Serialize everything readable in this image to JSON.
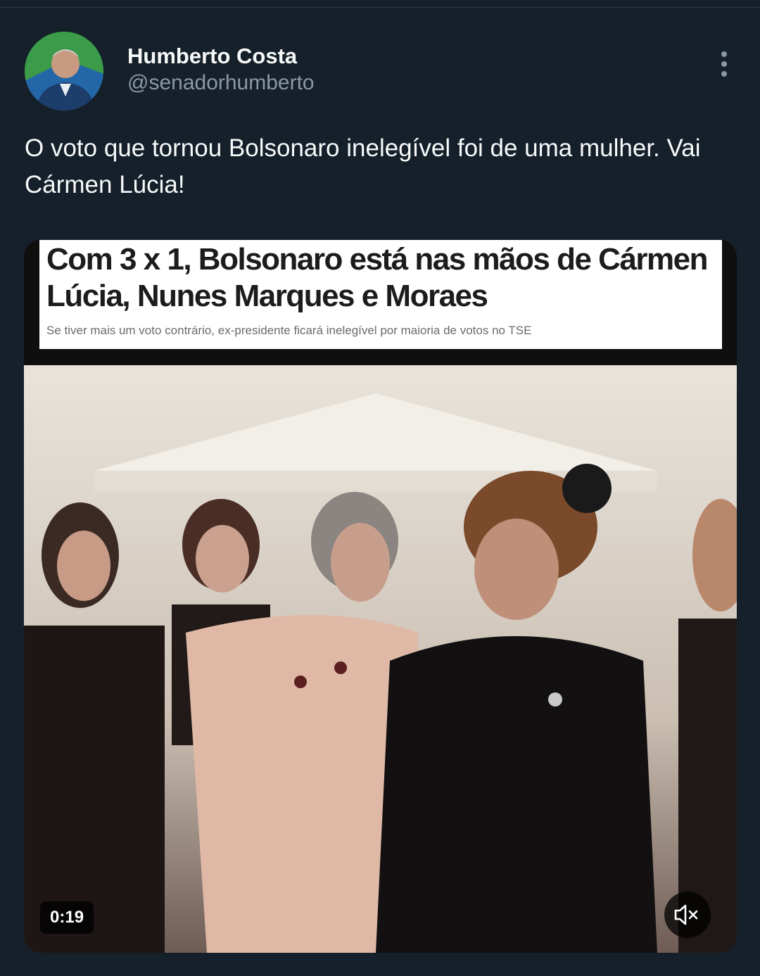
{
  "author": {
    "display_name": "Humberto Costa",
    "handle": "@senadorhumberto"
  },
  "tweet": {
    "text": "O voto que tornou Bolsonaro inelegível foi de uma mulher. Vai Cármen Lúcia!"
  },
  "media": {
    "headline": "Com 3 x 1, Bolsonaro está nas mãos de Cármen Lúcia, Nunes Marques e Moraes",
    "subheadline": "Se tiver mais um voto contrário, ex-presidente ficará inelegível por maioria de votos no TSE",
    "duration": "0:19"
  },
  "icons": {
    "more": "more-vertical-icon",
    "mute": "speaker-muted-icon"
  },
  "colors": {
    "background": "#15202b",
    "text_primary": "#f7f9f9",
    "text_secondary": "#8b98a5"
  }
}
